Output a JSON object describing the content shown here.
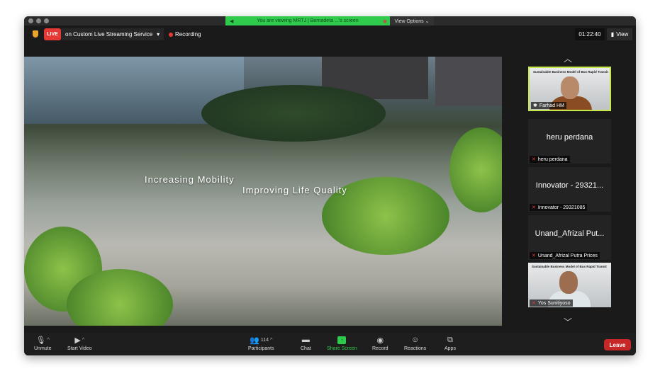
{
  "banner": {
    "text": "You are viewing MRTJ | Bernadeta ...'s screen",
    "view_options": "View Options ⌄"
  },
  "topbar": {
    "live": "LIVE",
    "stream": "on Custom Live Streaming Service",
    "recording": "Recording",
    "timer": "01:22:40",
    "view": "View"
  },
  "slide": {
    "line1": "Increasing Mobility",
    "line2": "Improving Life Quality"
  },
  "participants": [
    {
      "name": "Farhad HM",
      "slide_title": "Sustainable Business Model of Bus Rapid Transit",
      "video": true,
      "active": true
    },
    {
      "name": "heru perdana",
      "display": "heru perdana",
      "muted": true
    },
    {
      "name": "Innovator - 29321085",
      "display": "Innovator - 29321...",
      "muted": true
    },
    {
      "name": "Unand_Afrizal Putra Prices",
      "display": "Unand_Afrizal Put...",
      "muted": true
    },
    {
      "name": "Yos Sunitiyoso",
      "slide_title": "Sustainable Business Model of Bus Rapid Transit",
      "video": true
    }
  ],
  "toolbar": {
    "unmute": "Unmute",
    "start_video": "Start Video",
    "participants": "Participants",
    "participant_count": "114",
    "chat": "Chat",
    "share_screen": "Share Screen",
    "record": "Record",
    "reactions": "Reactions",
    "apps": "Apps",
    "leave": "Leave"
  }
}
